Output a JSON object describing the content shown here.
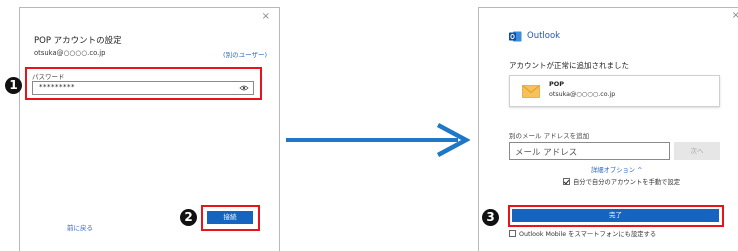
{
  "left_dialog": {
    "close_glyph": "×",
    "title": "POP アカウントの設定",
    "email": "otsuka@○○○○.co.jp",
    "other_user_link": "(別のユーザー)",
    "password_label": "パスワード",
    "password_value": "*********",
    "back_link": "前に戻る",
    "connect_button": "接続"
  },
  "steps": {
    "step1": "1",
    "step2": "2",
    "step3": "3"
  },
  "right_dialog": {
    "close_glyph": "×",
    "app_name": "Outlook",
    "added_message": "アカウントが正常に追加されました",
    "account_type": "POP",
    "account_email": "otsuka@○○○○.co.jp",
    "add_email_label": "別のメール アドレスを追加",
    "email_placeholder": "メール アドレス",
    "next_button": "次へ",
    "advanced_options": "詳細オプション ^",
    "manual_setup_label": "自分で自分のアカウントを手動で設定",
    "manual_setup_checked": true,
    "done_button": "完了",
    "mobile_setup_label": "Outlook Mobile をスマートフォンにも設定する",
    "mobile_setup_checked": false
  },
  "colors": {
    "accent_blue": "#1565c0",
    "highlight_red": "#e8141b",
    "link_blue": "#2b66c4",
    "arrow_blue": "#1f77c8"
  },
  "icons": [
    "close-icon",
    "eye-icon",
    "arrow-right-icon",
    "outlook-logo-icon",
    "mail-icon",
    "chevron-up-icon",
    "checkbox-icon"
  ]
}
